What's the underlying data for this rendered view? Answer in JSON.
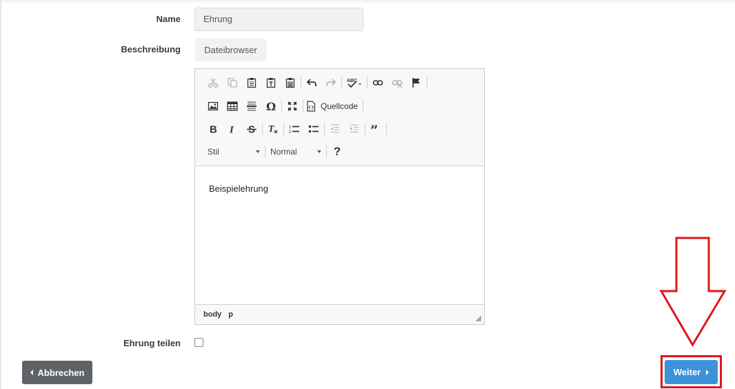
{
  "form": {
    "name_label": "Name",
    "name_value": "Ehrung",
    "description_label": "Beschreibung",
    "file_browser_label": "Dateibrowser",
    "share_label": "Ehrung teilen",
    "share_checked": false
  },
  "editor": {
    "toolbar": {
      "source_label": "Quellcode",
      "style_combo": "Stil",
      "format_combo": "Normal",
      "help_label": "?"
    },
    "content_text": "Beispielehrung",
    "status_path": [
      "body",
      "p"
    ]
  },
  "actions": {
    "cancel_label": "Abbrechen",
    "next_label": "Weiter"
  },
  "colors": {
    "primary": "#3c93dc",
    "secondary": "#5f6368",
    "annotation": "#e0151b"
  }
}
